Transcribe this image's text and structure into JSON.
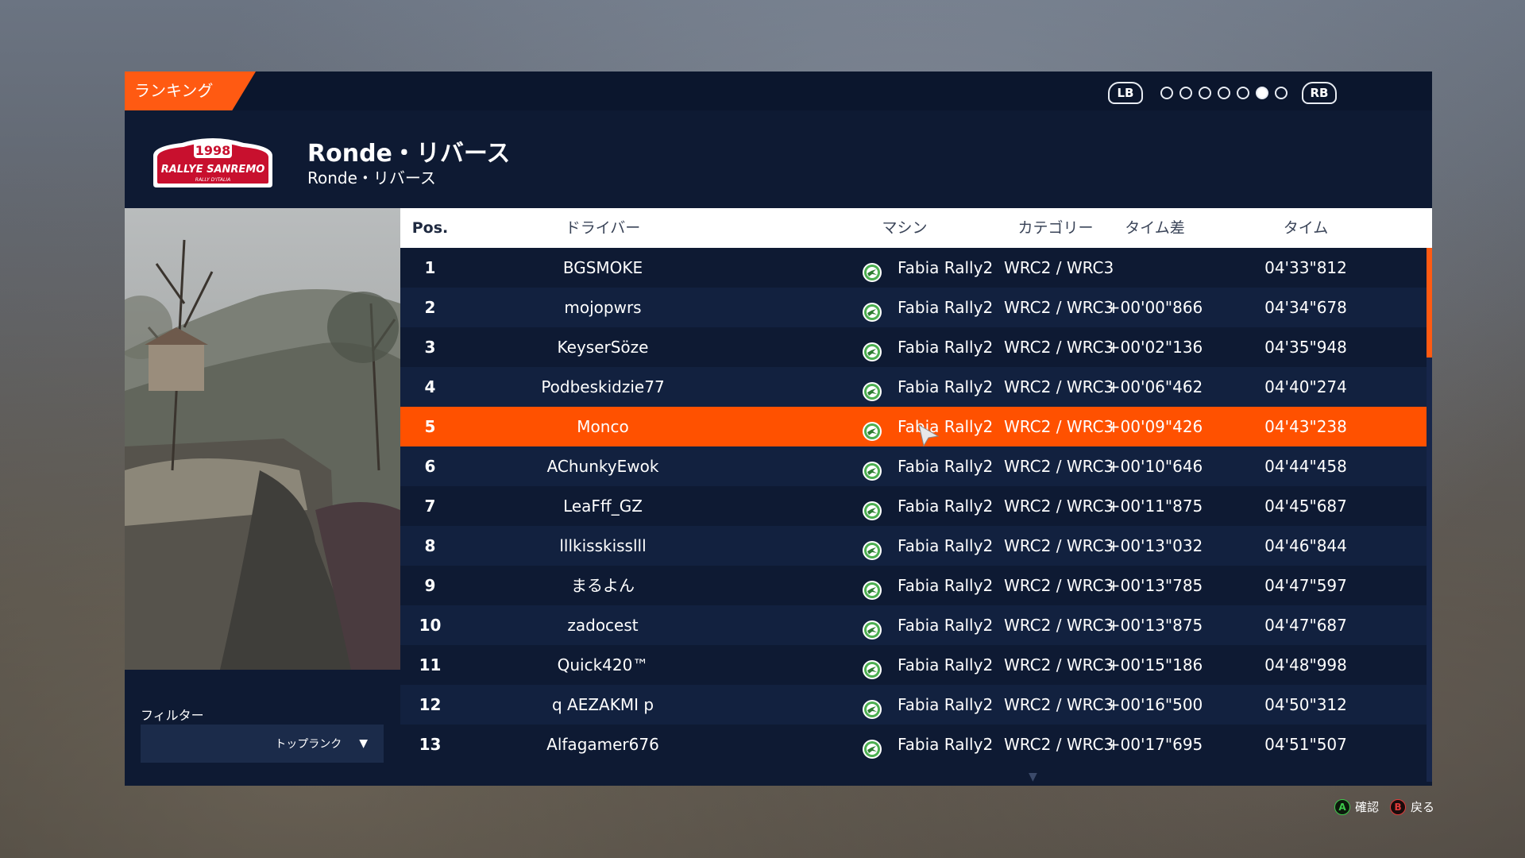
{
  "header": {
    "section_tab": "ランキング",
    "pager": {
      "left_bumper": "LB",
      "right_bumper": "RB",
      "page_count": 7,
      "active_page": 6
    }
  },
  "event": {
    "logo": {
      "year": "1998",
      "name": "RALLYE SANREMO",
      "subtitle": "RALLY D'ITALIA"
    },
    "title": "Ronde・リバース",
    "subtitle": "Ronde・リバース"
  },
  "filter": {
    "label": "フィルター",
    "value": "トップランク"
  },
  "table": {
    "columns": {
      "pos": "Pos.",
      "driver": "ドライバー",
      "car": "マシン",
      "category": "カテゴリー",
      "diff": "タイム差",
      "time": "タイム"
    },
    "rows": [
      {
        "pos": "1",
        "driver": "BGSMOKE",
        "car": "Fabia Rally2",
        "category": "WRC2 / WRC3",
        "diff": "",
        "time": "04'33\"812"
      },
      {
        "pos": "2",
        "driver": "mojopwrs",
        "car": "Fabia Rally2",
        "category": "WRC2 / WRC3",
        "diff": "+00'00\"866",
        "time": "04'34\"678"
      },
      {
        "pos": "3",
        "driver": "KeyserSöze",
        "car": "Fabia Rally2",
        "category": "WRC2 / WRC3",
        "diff": "+00'02\"136",
        "time": "04'35\"948"
      },
      {
        "pos": "4",
        "driver": "Podbeskidzie77",
        "car": "Fabia Rally2",
        "category": "WRC2 / WRC3",
        "diff": "+00'06\"462",
        "time": "04'40\"274"
      },
      {
        "pos": "5",
        "driver": "Monco",
        "car": "Fabia Rally2",
        "category": "WRC2 / WRC3",
        "diff": "+00'09\"426",
        "time": "04'43\"238"
      },
      {
        "pos": "6",
        "driver": "AChunkyEwok",
        "car": "Fabia Rally2",
        "category": "WRC2 / WRC3",
        "diff": "+00'10\"646",
        "time": "04'44\"458"
      },
      {
        "pos": "7",
        "driver": "LeaFff_GZ",
        "car": "Fabia Rally2",
        "category": "WRC2 / WRC3",
        "diff": "+00'11\"875",
        "time": "04'45\"687"
      },
      {
        "pos": "8",
        "driver": "lllkisskisslll",
        "car": "Fabia Rally2",
        "category": "WRC2 / WRC3",
        "diff": "+00'13\"032",
        "time": "04'46\"844"
      },
      {
        "pos": "9",
        "driver": "まるよん",
        "car": "Fabia Rally2",
        "category": "WRC2 / WRC3",
        "diff": "+00'13\"785",
        "time": "04'47\"597"
      },
      {
        "pos": "10",
        "driver": "zadocest",
        "car": "Fabia Rally2",
        "category": "WRC2 / WRC3",
        "diff": "+00'13\"875",
        "time": "04'47\"687"
      },
      {
        "pos": "11",
        "driver": "Quick420™",
        "car": "Fabia Rally2",
        "category": "WRC2 / WRC3",
        "diff": "+00'15\"186",
        "time": "04'48\"998"
      },
      {
        "pos": "12",
        "driver": "q AEZAKMI p",
        "car": "Fabia Rally2",
        "category": "WRC2 / WRC3",
        "diff": "+00'16\"500",
        "time": "04'50\"312"
      },
      {
        "pos": "13",
        "driver": "Alfagamer676",
        "car": "Fabia Rally2",
        "category": "WRC2 / WRC3",
        "diff": "+00'17\"695",
        "time": "04'51\"507"
      }
    ],
    "selected_pos": "5"
  },
  "footer": {
    "confirm_button": "A",
    "confirm_label": "確認",
    "back_button": "B",
    "back_label": "戻る"
  },
  "colors": {
    "accent": "#ff5a12",
    "panel": "#0e1a33",
    "row_alt": "#12213f",
    "header_bg": "#ffffff",
    "skoda_green": "#4caf50"
  }
}
